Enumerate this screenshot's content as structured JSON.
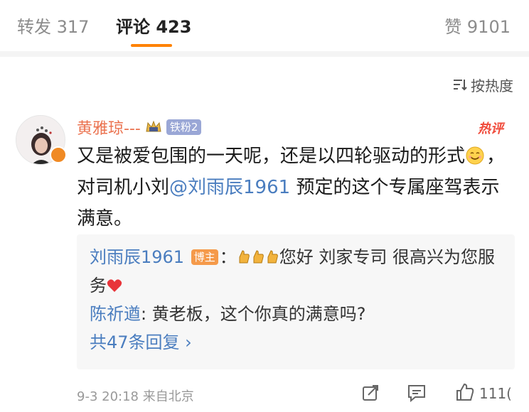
{
  "tabs": {
    "repost": "转发 317",
    "comments": "评论 423",
    "likes": "赞 9101"
  },
  "sort": {
    "label": "按热度"
  },
  "comment": {
    "username": "黄雅琼---",
    "fan_badge": "铁粉2",
    "hot_tag": "热评",
    "text_part1": "又是被爱包围的一天呢，还是以四轮驱动的形式",
    "text_part2": "，对司机小刘",
    "mention": "@刘雨辰1961",
    "text_part3": " 预定的这个专属座驾表示满意。",
    "replies": [
      {
        "name": "刘雨辰1961",
        "badge": "博主",
        "text_prefix": "：",
        "text": "您好 刘家专司 很高兴为您服务"
      },
      {
        "name": "陈祈遒",
        "text": ": 黄老板，这个你真的满意吗?"
      }
    ],
    "more_replies": "共47条回复 ›",
    "timestamp": "9-3 20:18 来自北京",
    "like_count": "111("
  },
  "colors": {
    "accent": "#ff8200",
    "link": "#4a7dbf",
    "username": "#eb7350"
  }
}
